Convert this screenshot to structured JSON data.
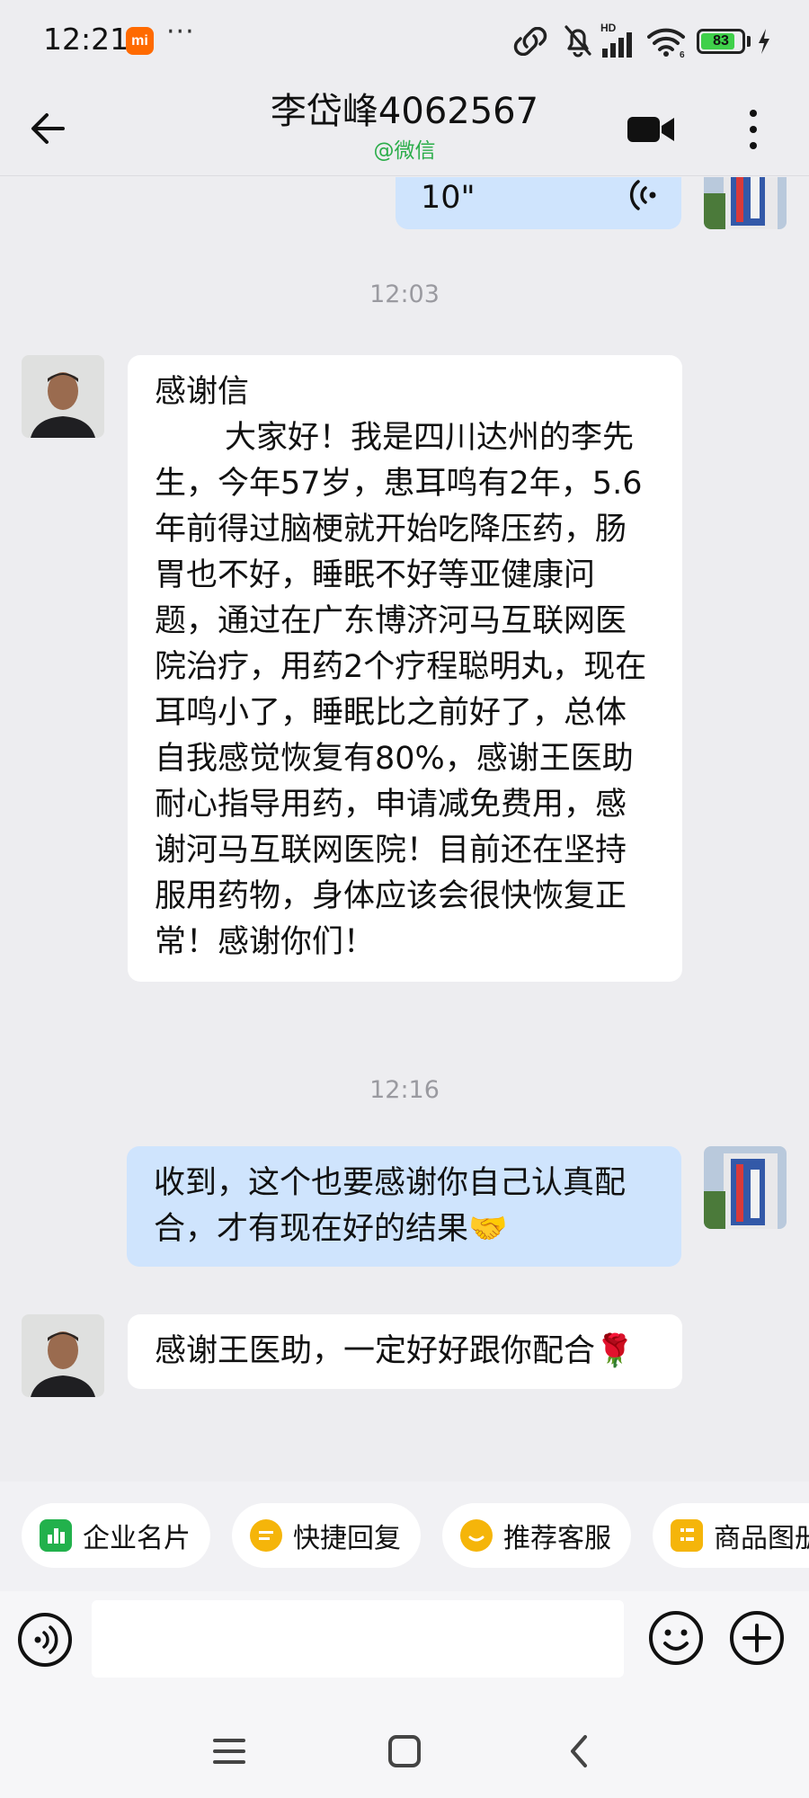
{
  "status_bar": {
    "time": "12:21",
    "badge": "mi",
    "more": "···",
    "network": "HD",
    "battery": "83",
    "battery_level": 0.83
  },
  "header": {
    "title": "李岱峰4062567",
    "subtitle": "@微信",
    "back_icon": "arrow-left-icon",
    "video_icon": "video-call-icon",
    "more_icon": "more-vertical-icon"
  },
  "messages": {
    "voice": {
      "duration": "10\""
    },
    "time1": "12:03",
    "letter": {
      "title": "感谢信",
      "body": "大家好！我是四川达州的李先生，今年57岁，患耳鸣有2年，5.6年前得过脑梗就开始吃降压药，肠胃也不好，睡眠不好等亚健康问题，通过在广东博济河马互联网医院治疗，用药2个疗程聪明丸，现在耳鸣小了，睡眠比之前好了，总体自我感觉恢复有80%，感谢王医助耐心指导用药，申请减免费用，感谢河马互联网医院！目前还在坚持服用药物，身体应该会很快恢复正常！感谢你们！"
    },
    "time2": "12:16",
    "reply": "收到，这个也要感谢你自己认真配合，才有现在好的结果🤝",
    "last": "感谢王医助，一定好好跟你配合🌹"
  },
  "toolbar": {
    "chips": [
      {
        "label": "企业名片",
        "icon": "business-card-icon",
        "color": "#22b14c"
      },
      {
        "label": "快捷回复",
        "icon": "quick-reply-icon",
        "color": "#f5b50a"
      },
      {
        "label": "推荐客服",
        "icon": "recommend-service-icon",
        "color": "#f5b50a"
      },
      {
        "label": "商品图册",
        "icon": "product-album-icon",
        "color": "#f5b50a"
      }
    ]
  },
  "input": {
    "value": "",
    "placeholder": "",
    "voice_icon": "voice-input-icon",
    "emoji_icon": "emoji-icon",
    "plus_icon": "plus-icon"
  },
  "nav": {
    "menu_icon": "menu-icon",
    "home_icon": "home-square-icon",
    "back_icon": "nav-back-icon"
  }
}
